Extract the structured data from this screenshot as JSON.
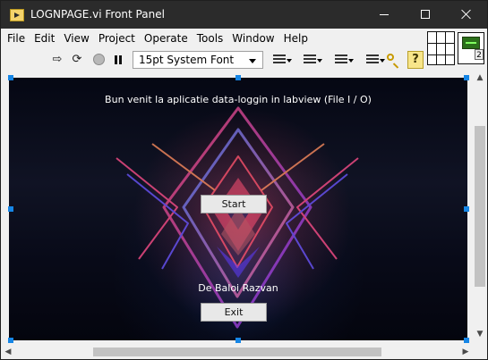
{
  "window": {
    "title": "LOGNPAGE.vi Front Panel"
  },
  "menu": {
    "items": [
      "File",
      "Edit",
      "View",
      "Project",
      "Operate",
      "Tools",
      "Window",
      "Help"
    ]
  },
  "toolbar": {
    "run_icon": "run-arrow-icon",
    "run_continuous_icon": "run-continuously-icon",
    "abort_icon": "abort-execution-icon",
    "pause_icon": "pause-icon",
    "font_value": "15pt System Font",
    "align_icon": "align-objects-icon",
    "distribute_icon": "distribute-objects-icon",
    "resize_icon": "resize-objects-icon",
    "reorder_icon": "reorder-objects-icon",
    "search_icon": "search-icon",
    "help_label": "?"
  },
  "panel": {
    "welcome": "Bun venit la aplicatie data-loggin in labview (File I / O)",
    "start_label": "Start",
    "author": "De Baloi Razvan",
    "exit_label": "Exit"
  },
  "connector": {
    "badge": "2"
  }
}
